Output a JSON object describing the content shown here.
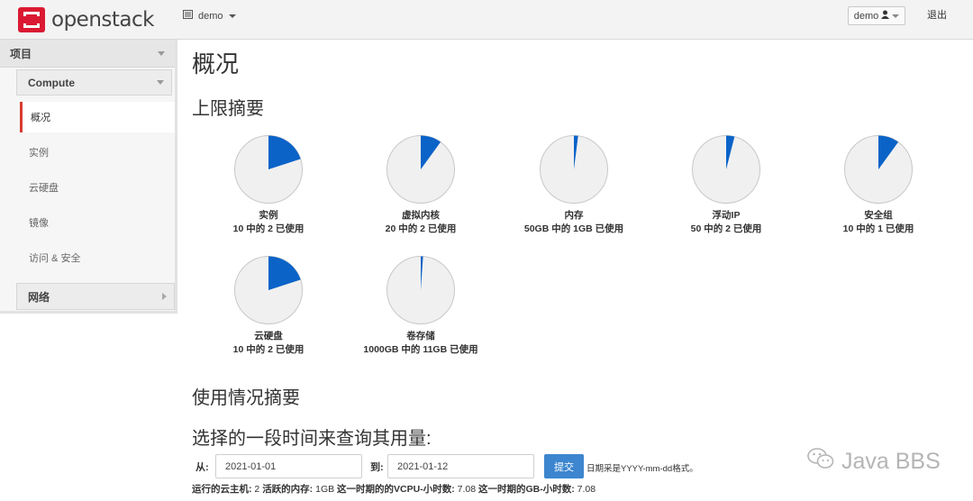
{
  "header": {
    "brand": "openstack",
    "project": "demo",
    "user": "demo",
    "logout": "退出"
  },
  "sidebar": {
    "section": "项目",
    "group": "Compute",
    "items": [
      "概况",
      "实例",
      "云硬盘",
      "镜像",
      "访问 & 安全"
    ],
    "network": "网络"
  },
  "page": {
    "title": "概况",
    "limits_title": "上限摘要",
    "usage_title": "使用情况摘要",
    "period_title": "选择的一段时间来查询其用量:"
  },
  "quotas": [
    {
      "name": "实例",
      "text": "10 中的 2 已使用",
      "used": 2,
      "total": 10
    },
    {
      "name": "虚拟内核",
      "text": "20 中的 2 已使用",
      "used": 2,
      "total": 20
    },
    {
      "name": "内存",
      "text": "50GB 中的 1GB 已使用",
      "used": 1,
      "total": 50
    },
    {
      "name": "浮动IP",
      "text": "50 中的 2 已使用",
      "used": 2,
      "total": 50
    },
    {
      "name": "安全组",
      "text": "10 中的 1 已使用",
      "used": 1,
      "total": 10
    },
    {
      "name": "云硬盘",
      "text": "10 中的 2 已使用",
      "used": 2,
      "total": 10
    },
    {
      "name": "卷存储",
      "text": "1000GB 中的 11GB 已使用",
      "used": 11,
      "total": 1000
    }
  ],
  "form": {
    "from_label": "从:",
    "from_value": "2021-01-01",
    "to_label": "到:",
    "to_value": "2021-01-12",
    "submit": "提交",
    "hint": "日期采是YYYY-mm-dd格式。"
  },
  "stats": {
    "instances_label": "运行的云主机:",
    "instances": "2",
    "ram_label": "活跃的内存:",
    "ram": "1GB",
    "vcpu_label": "这一时期的的VCPU-小时数:",
    "vcpu": "7.08",
    "gb_label": "这一时期的GB-小时数:",
    "gb": "7.08"
  },
  "watermark": "Java BBS",
  "colors": {
    "accent": "#0b63c8",
    "pie_bg": "#f0f0f0",
    "active_marker": "#d83c2f",
    "logo_red": "#da1a32",
    "button_blue": "#3d86cf"
  },
  "icons": {
    "logo": "openstack-logo-icon",
    "project": "project-list-icon",
    "user": "user-icon",
    "watermark": "wechat-icon"
  }
}
